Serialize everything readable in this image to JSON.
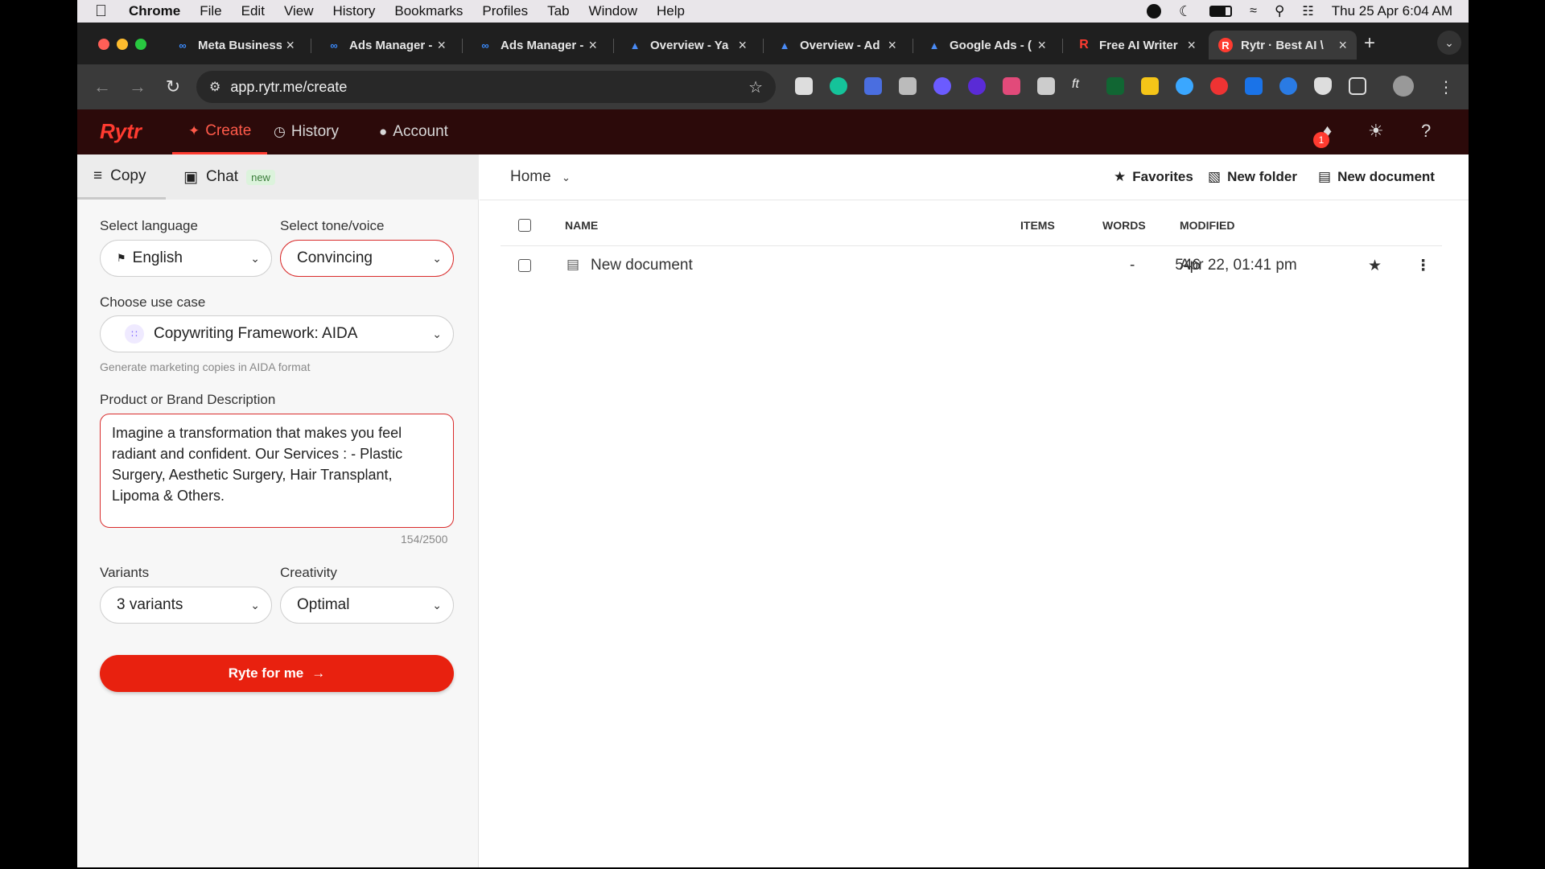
{
  "menubar": {
    "app": "Chrome",
    "items": [
      "File",
      "Edit",
      "View",
      "History",
      "Bookmarks",
      "Profiles",
      "Tab",
      "Window",
      "Help"
    ],
    "clock": "Thu 25 Apr  6:04 AM"
  },
  "tabs": [
    {
      "title": "Meta Business",
      "icon": "meta-icon"
    },
    {
      "title": "Ads Manager -",
      "icon": "meta-icon"
    },
    {
      "title": "Ads Manager -",
      "icon": "meta-icon"
    },
    {
      "title": "Overview - Ya",
      "icon": "google-ads-icon"
    },
    {
      "title": "Overview - Ad",
      "icon": "google-ads-icon"
    },
    {
      "title": "Google Ads - (",
      "icon": "google-ads-icon"
    },
    {
      "title": "Free AI Writer",
      "icon": "rytr-icon"
    },
    {
      "title": "Rytr · Best AI \\",
      "icon": "rytr-icon",
      "active": true
    }
  ],
  "address": {
    "url": "app.rytr.me/create"
  },
  "app": {
    "logo": "Rytr",
    "nav": {
      "create": "Create",
      "history": "History",
      "account": "Account"
    },
    "notification_count": "1"
  },
  "left": {
    "tabs": {
      "copy": "Copy",
      "chat": "Chat",
      "chat_badge": "new"
    },
    "language_label": "Select language",
    "language_value": "English",
    "tone_label": "Select tone/voice",
    "tone_value": "Convincing",
    "usecase_label": "Choose use case",
    "usecase_value": "Copywriting Framework: AIDA",
    "usecase_help": "Generate marketing copies in AIDA format",
    "description_label": "Product or Brand Description",
    "description_value": "Imagine a transformation that makes you feel radiant and confident. Our Services : - Plastic Surgery, Aesthetic Surgery, Hair Transplant, Lipoma & Others.",
    "char_count": "154/2500",
    "variants_label": "Variants",
    "variants_value": "3 variants",
    "creativity_label": "Creativity",
    "creativity_value": "Optimal",
    "submit_label": "Ryte for me"
  },
  "right": {
    "breadcrumb": "Home",
    "actions": {
      "favorites": "Favorites",
      "new_folder": "New folder",
      "new_document": "New document"
    },
    "columns": {
      "name": "NAME",
      "items": "ITEMS",
      "words": "WORDS",
      "modified": "MODIFIED"
    },
    "rows": [
      {
        "name": "New document",
        "items": "-",
        "words": "546",
        "modified": "Apr 22, 01:41 pm"
      }
    ]
  },
  "colors": {
    "brand": "#e8210f",
    "header_bg": "#2c0a0a"
  }
}
